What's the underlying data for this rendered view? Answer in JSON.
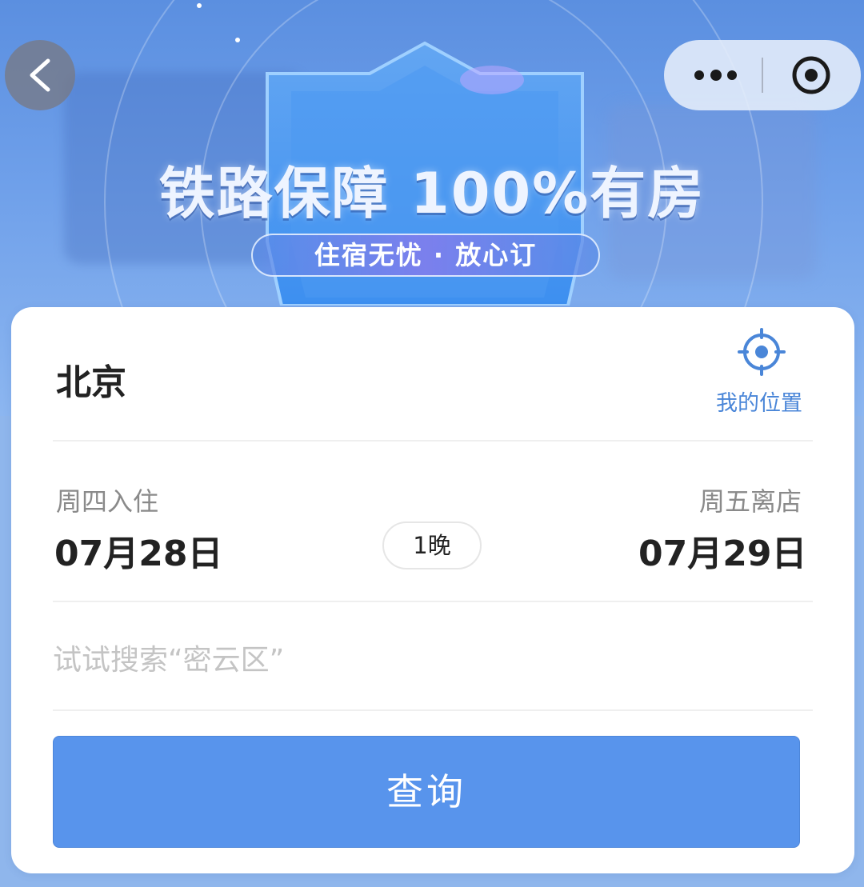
{
  "banner": {
    "slogan": "铁路保障 100%有房",
    "subslogan": "住宿无忧 · 放心订"
  },
  "nav": {
    "back_icon": "chevron-left-icon",
    "more_icon": "more-dots-icon",
    "close_icon": "target-close-icon"
  },
  "search_form": {
    "city": "北京",
    "location_label": "我的位置",
    "location_icon": "locate-crosshair-icon",
    "checkin": {
      "label": "周四入住",
      "date": "07月28日"
    },
    "checkout": {
      "label": "周五离店",
      "date": "07月29日"
    },
    "nights": "1晚",
    "keyword_placeholder": "试试搜索“密云区”",
    "submit_label": "查询"
  },
  "colors": {
    "accent": "#5894ec",
    "location_blue": "#4a86d8",
    "banner_blue": "#6fa0ea"
  }
}
